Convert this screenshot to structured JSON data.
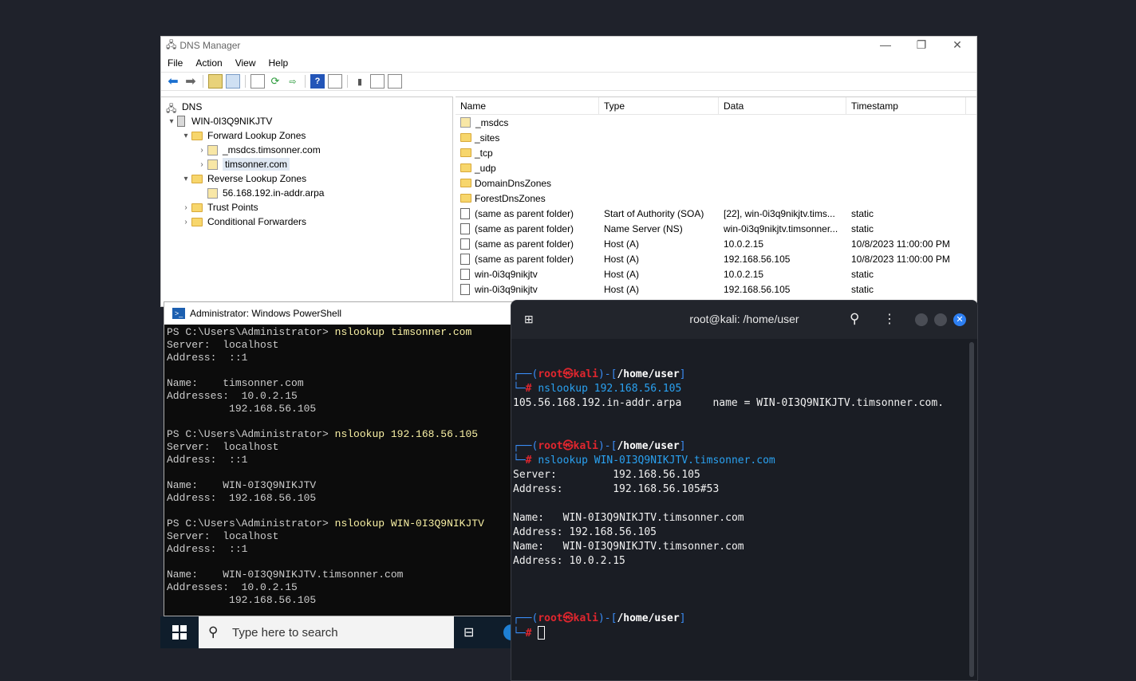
{
  "dns": {
    "title": "DNS Manager",
    "menu": [
      "File",
      "Action",
      "View",
      "Help"
    ],
    "tree": {
      "root": "DNS",
      "server": "WIN-0I3Q9NIKJTV",
      "forward": "Forward Lookup Zones",
      "msdcs": "_msdcs.timsonner.com",
      "zone": "timsonner.com",
      "reverse": "Reverse Lookup Zones",
      "rev_zone": "56.168.192.in-addr.arpa",
      "trust": "Trust Points",
      "cond": "Conditional Forwarders"
    },
    "columns": [
      "Name",
      "Type",
      "Data",
      "Timestamp"
    ],
    "rows": [
      {
        "name": "_msdcs",
        "type": "",
        "data": "",
        "ts": ""
      },
      {
        "name": "_sites",
        "type": "",
        "data": "",
        "ts": ""
      },
      {
        "name": "_tcp",
        "type": "",
        "data": "",
        "ts": ""
      },
      {
        "name": "_udp",
        "type": "",
        "data": "",
        "ts": ""
      },
      {
        "name": "DomainDnsZones",
        "type": "",
        "data": "",
        "ts": ""
      },
      {
        "name": "ForestDnsZones",
        "type": "",
        "data": "",
        "ts": ""
      },
      {
        "name": "(same as parent folder)",
        "type": "Start of Authority (SOA)",
        "data": "[22], win-0i3q9nikjtv.tims...",
        "ts": "static"
      },
      {
        "name": "(same as parent folder)",
        "type": "Name Server (NS)",
        "data": "win-0i3q9nikjtv.timsonner...",
        "ts": "static"
      },
      {
        "name": "(same as parent folder)",
        "type": "Host (A)",
        "data": "10.0.2.15",
        "ts": "10/8/2023 11:00:00 PM"
      },
      {
        "name": "(same as parent folder)",
        "type": "Host (A)",
        "data": "192.168.56.105",
        "ts": "10/8/2023 11:00:00 PM"
      },
      {
        "name": "win-0i3q9nikjtv",
        "type": "Host (A)",
        "data": "10.0.2.15",
        "ts": "static"
      },
      {
        "name": "win-0i3q9nikjtv",
        "type": "Host (A)",
        "data": "192.168.56.105",
        "ts": "static"
      }
    ]
  },
  "ps": {
    "title": "Administrator: Windows PowerShell",
    "prompt": "PS C:\\Users\\Administrator> ",
    "cmd1": "nslookup timsonner.com",
    "cmd2": "nslookup 192.168.56.105",
    "cmd3": "nslookup WIN-0I3Q9NIKJTV",
    "out1": "Server:  localhost\nAddress:  ::1\n\nName:    timsonner.com\nAddresses:  10.0.2.15\n          192.168.56.105\n",
    "out2": "Server:  localhost\nAddress:  ::1\n\nName:    WIN-0I3Q9NIKJTV\nAddress:  192.168.56.105\n",
    "out3": "Server:  localhost\nAddress:  ::1\n\nName:    WIN-0I3Q9NIKJTV.timsonner.com\nAddresses:  10.0.2.15\n          192.168.56.105"
  },
  "taskbar": {
    "search_placeholder": "Type here to search"
  },
  "kali": {
    "title": "root@kali: /home/user",
    "user": "root",
    "at": "㉿",
    "host": "kali",
    "cwd": "/home/user",
    "cmd1": "nslookup 192.168.56.105",
    "out1": "105.56.168.192.in-addr.arpa\tname = WIN-0I3Q9NIKJTV.timsonner.com.",
    "cmd2": "nslookup WIN-0I3Q9NIKJTV.timsonner.com",
    "out2": "Server:\t\t192.168.56.105\nAddress:\t192.168.56.105#53\n\nName:\tWIN-0I3Q9NIKJTV.timsonner.com\nAddress: 192.168.56.105\nName:\tWIN-0I3Q9NIKJTV.timsonner.com\nAddress: 10.0.2.15"
  }
}
